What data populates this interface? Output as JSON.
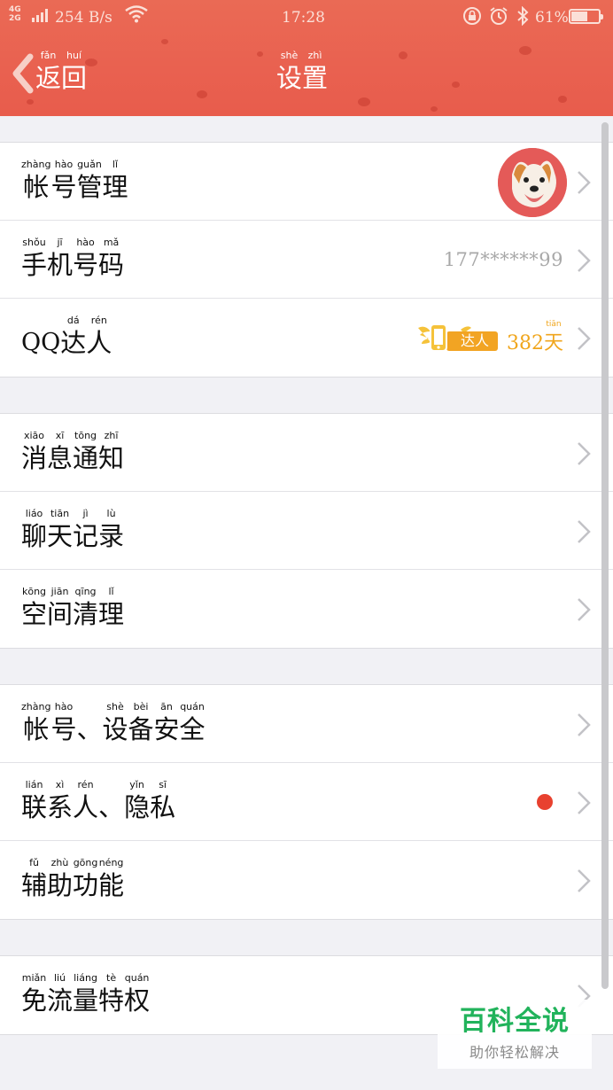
{
  "status_bar": {
    "network_top": "4G",
    "network_bottom": "2G",
    "speed": "254 B/s",
    "time": "17:28",
    "battery_pct": "61%",
    "battery_level": 0.61,
    "icons": [
      "lock-rotation-icon",
      "alarm-icon",
      "bluetooth-icon"
    ]
  },
  "nav": {
    "back": [
      {
        "py": "fǎn",
        "hz": "返"
      },
      {
        "py": "huí",
        "hz": "回"
      }
    ],
    "title": [
      {
        "py": "shè",
        "hz": "设"
      },
      {
        "py": "zhì",
        "hz": "置"
      }
    ]
  },
  "groups": [
    {
      "rows": [
        {
          "id": "account-management",
          "label": [
            {
              "py": "zhàng",
              "hz": "帐"
            },
            {
              "py": "hào",
              "hz": "号"
            },
            {
              "py": "guǎn",
              "hz": "管"
            },
            {
              "py": "lǐ",
              "hz": "理"
            }
          ],
          "accessory": "avatar"
        },
        {
          "id": "phone-number",
          "label": [
            {
              "py": "shǒu",
              "hz": "手"
            },
            {
              "py": "jī",
              "hz": "机"
            },
            {
              "py": "hào",
              "hz": "号"
            },
            {
              "py": "mǎ",
              "hz": "码"
            }
          ],
          "accessory": "value",
          "value": "177******99"
        },
        {
          "id": "qq-talent",
          "prefix": "QQ",
          "label": [
            {
              "py": "dá",
              "hz": "达"
            },
            {
              "py": "rén",
              "hz": "人"
            }
          ],
          "accessory": "badge",
          "badge_text": "达人",
          "days_num": "382",
          "days_unit": {
            "py": "tiān",
            "hz": "天"
          }
        }
      ]
    },
    {
      "rows": [
        {
          "id": "message-notifications",
          "label": [
            {
              "py": "xiāo",
              "hz": "消"
            },
            {
              "py": "xī",
              "hz": "息"
            },
            {
              "py": "tōng",
              "hz": "通"
            },
            {
              "py": "zhī",
              "hz": "知"
            }
          ]
        },
        {
          "id": "chat-history",
          "label": [
            {
              "py": "liáo",
              "hz": "聊"
            },
            {
              "py": "tiān",
              "hz": "天"
            },
            {
              "py": "jì",
              "hz": "记"
            },
            {
              "py": "lù",
              "hz": "录"
            }
          ]
        },
        {
          "id": "storage-cleanup",
          "label": [
            {
              "py": "kōng",
              "hz": "空"
            },
            {
              "py": "jiān",
              "hz": "间"
            },
            {
              "py": "qīng",
              "hz": "清"
            },
            {
              "py": "lǐ",
              "hz": "理"
            }
          ]
        }
      ]
    },
    {
      "rows": [
        {
          "id": "account-device-security",
          "label": [
            {
              "py": "zhàng",
              "hz": "帐"
            },
            {
              "py": "hào",
              "hz": "号"
            },
            {
              "py": "",
              "hz": "、"
            },
            {
              "py": "shè",
              "hz": "设"
            },
            {
              "py": "bèi",
              "hz": "备"
            },
            {
              "py": "ān",
              "hz": "安"
            },
            {
              "py": "quán",
              "hz": "全"
            }
          ]
        },
        {
          "id": "contacts-privacy",
          "label": [
            {
              "py": "lián",
              "hz": "联"
            },
            {
              "py": "xì",
              "hz": "系"
            },
            {
              "py": "rén",
              "hz": "人"
            },
            {
              "py": "",
              "hz": "、"
            },
            {
              "py": "yǐn",
              "hz": "隐"
            },
            {
              "py": "sī",
              "hz": "私"
            }
          ],
          "accessory": "dot"
        },
        {
          "id": "accessibility",
          "label": [
            {
              "py": "fǔ",
              "hz": "辅"
            },
            {
              "py": "zhù",
              "hz": "助"
            },
            {
              "py": "gōng",
              "hz": "功"
            },
            {
              "py": "néng",
              "hz": "能"
            }
          ]
        }
      ]
    },
    {
      "rows": [
        {
          "id": "free-data-privilege",
          "label": [
            {
              "py": "miǎn",
              "hz": "免"
            },
            {
              "py": "liú",
              "hz": "流"
            },
            {
              "py": "liáng",
              "hz": "量"
            },
            {
              "py": "tè",
              "hz": "特"
            },
            {
              "py": "quán",
              "hz": "权"
            }
          ]
        }
      ]
    }
  ],
  "watermark": {
    "title": "百科全说",
    "subtitle": "助你轻松解决"
  },
  "colors": {
    "header": "#e96150",
    "accent_gold": "#f0a61d",
    "dot_red": "#e8412f",
    "watermark_green": "#21b35b"
  }
}
